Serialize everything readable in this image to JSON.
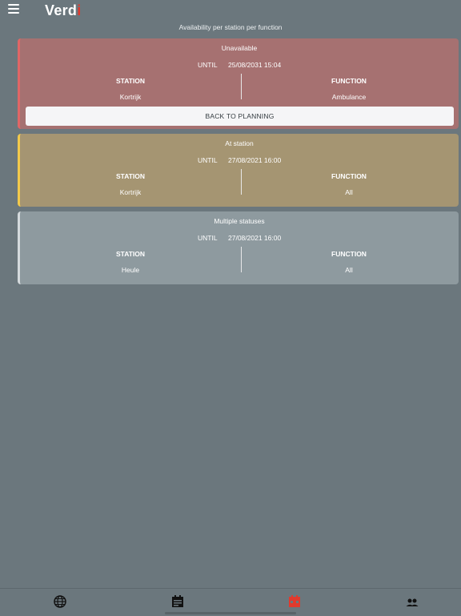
{
  "app": {
    "logo_main": "Verd",
    "logo_accent": "i",
    "accent_color": "#e03a2e"
  },
  "page": {
    "subtitle": "Availability per station per function"
  },
  "cards": [
    {
      "status": "Unavailable",
      "until_label": "UNTIL",
      "until_value": "25/08/2031 15:04",
      "station_label": "STATION",
      "station_value": "Kortrijk",
      "function_label": "FUNCTION",
      "function_value": "Ambulance",
      "button_label": "BACK TO PLANNING",
      "color": "#a67171"
    },
    {
      "status": "At station",
      "until_label": "UNTIL",
      "until_value": "27/08/2021 16:00",
      "station_label": "STATION",
      "station_value": "Kortrijk",
      "function_label": "FUNCTION",
      "function_value": "All",
      "color": "#a59572"
    },
    {
      "status": "Multiple statuses",
      "until_label": "UNTIL",
      "until_value": "27/08/2021 16:00",
      "station_label": "STATION",
      "station_value": "Heule",
      "function_label": "FUNCTION",
      "function_value": "All",
      "color": "#8e9a9f"
    }
  ],
  "tabbar": {
    "tabs": [
      {
        "icon": "globe-icon"
      },
      {
        "icon": "calendar-icon"
      },
      {
        "icon": "calendar-alert-icon",
        "active": true,
        "color": "#e03a2e"
      },
      {
        "icon": "people-icon"
      }
    ]
  }
}
